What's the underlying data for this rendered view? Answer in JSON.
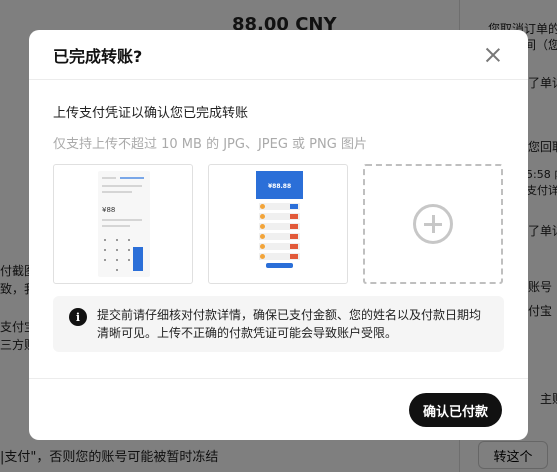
{
  "background": {
    "amount": "88.00 CNY",
    "right_lines": [
      "您取消订单的",
      "下单时间（您的",
      "了单详",
      "您回取",
      "5:58 内",
      "支付详情页",
      "了单详",
      "账号",
      "付宝",
      "主账号"
    ],
    "left_lines": [
      "付截图",
      "致，我",
      "支付宝",
      "三方账"
    ],
    "bottom_text": "|支付\"，否则您的账号可能被暂时冻结",
    "bottom_button": "转这个"
  },
  "modal": {
    "title": "已完成转账?",
    "upload_title": "上传支付凭证以确认您已完成转账",
    "upload_hint": "仅支持上传不超过 10 MB 的 JPG、JPEG 或 PNG 图片",
    "thumb1": {
      "amount": "¥88"
    },
    "thumb2": {
      "amount": "¥88.88"
    },
    "notice_icon": "i",
    "notice": "提交前请仔细核对付款详情，确保已支付金额、您的姓名以及付款日期均清晰可见。上传不正确的付款凭证可能会导致账户受限。",
    "confirm_label": "确认已付款"
  },
  "icons": {
    "close": "close-icon",
    "add": "plus-circle-icon",
    "info": "info-icon"
  }
}
